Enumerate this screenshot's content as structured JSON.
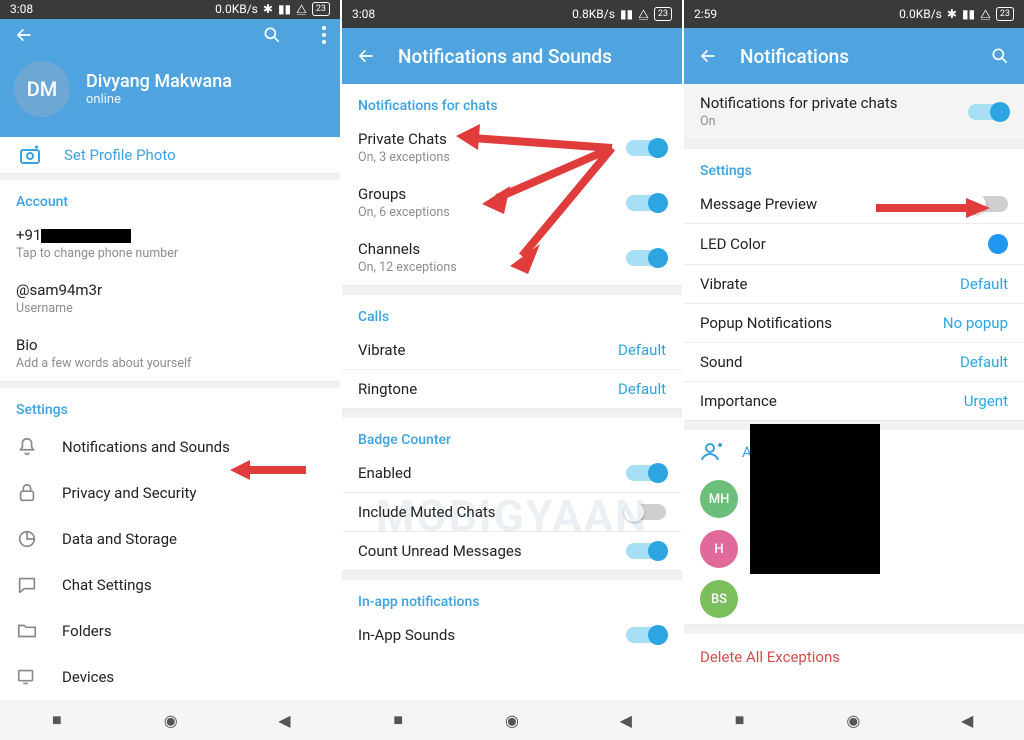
{
  "watermark": "MOBIGYAAN",
  "nav": {
    "square": "■",
    "circle": "◉",
    "tri": "◀"
  },
  "s1": {
    "status": {
      "time": "3:08",
      "net": "0.0KB/s",
      "batt": "23"
    },
    "profile": {
      "initials": "DM",
      "name": "Divyang Makwana",
      "status": "online"
    },
    "setphoto": "Set Profile Photo",
    "account": {
      "header": "Account",
      "phone_prefix": "+91",
      "phone_sub": "Tap to change phone number",
      "user": "@sam94m3r",
      "user_sub": "Username",
      "bio": "Bio",
      "bio_sub": "Add a few words about yourself"
    },
    "settings": {
      "header": "Settings",
      "items": [
        "Notifications and Sounds",
        "Privacy and Security",
        "Data and Storage",
        "Chat Settings",
        "Folders",
        "Devices"
      ]
    }
  },
  "s2": {
    "status": {
      "time": "3:08",
      "net": "0.8KB/s",
      "batt": "23"
    },
    "title": "Notifications and Sounds",
    "chats": {
      "header": "Notifications for chats",
      "priv": {
        "t": "Private Chats",
        "s": "On, 3 exceptions"
      },
      "grp": {
        "t": "Groups",
        "s": "On, 6 exceptions"
      },
      "chn": {
        "t": "Channels",
        "s": "On, 12 exceptions"
      }
    },
    "calls": {
      "header": "Calls",
      "vibrate": {
        "t": "Vibrate",
        "v": "Default"
      },
      "ring": {
        "t": "Ringtone",
        "v": "Default"
      }
    },
    "badge": {
      "header": "Badge Counter",
      "en": "Enabled",
      "mute": "Include Muted Chats",
      "unread": "Count Unread Messages"
    },
    "inapp": {
      "header": "In-app notifications",
      "sounds": "In-App Sounds"
    }
  },
  "s3": {
    "status": {
      "time": "2:59",
      "net": "0.0KB/s",
      "batt": "23"
    },
    "title": "Notifications",
    "top": {
      "t": "Notifications for private chats",
      "s": "On"
    },
    "settings": {
      "header": "Settings",
      "preview": "Message Preview",
      "led": "LED Color",
      "vib": {
        "t": "Vibrate",
        "v": "Default"
      },
      "pop": {
        "t": "Popup Notifications",
        "v": "No popup"
      },
      "snd": {
        "t": "Sound",
        "v": "Default"
      },
      "imp": {
        "t": "Importance",
        "v": "Urgent"
      }
    },
    "addex": "Add an Exception",
    "ex_avs": [
      "MH",
      "H",
      "BS"
    ],
    "delete": "Delete All Exceptions"
  }
}
